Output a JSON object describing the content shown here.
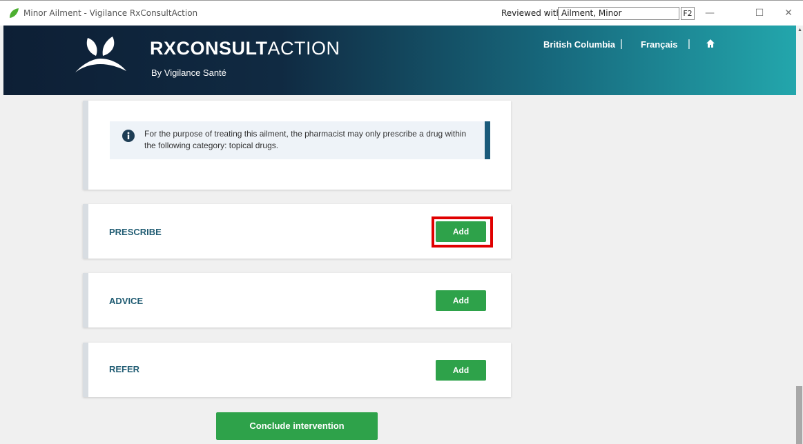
{
  "window": {
    "title": "Minor Ailment - Vigilance RxConsultAction",
    "reviewed_label": "Reviewed with",
    "reviewed_value": "Ailment, Minor",
    "f2_label": "F2",
    "minimize": "—",
    "maximize": "☐",
    "close": "✕"
  },
  "header": {
    "brand_bold": "RXCONSULT",
    "brand_light": "ACTION",
    "subtitle": "By Vigilance Santé",
    "nav_province": "British Columbia",
    "nav_language": "Français",
    "nav_sep": "|"
  },
  "info": {
    "text": "For the purpose of treating this ailment, the pharmacist may only prescribe a drug within the following category: topical drugs."
  },
  "sections": {
    "prescribe": {
      "label": "PRESCRIBE",
      "button": "Add"
    },
    "advice": {
      "label": "ADVICE",
      "button": "Add"
    },
    "refer": {
      "label": "REFER",
      "button": "Add"
    }
  },
  "conclude_button": "Conclude intervention",
  "colors": {
    "accent_green": "#2ea24a",
    "section_label": "#1f5b72",
    "highlight": "#e00000"
  }
}
